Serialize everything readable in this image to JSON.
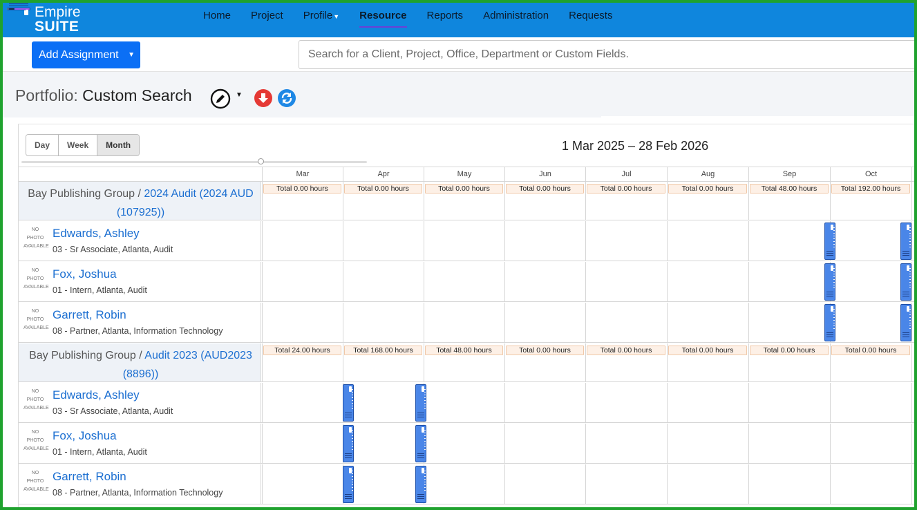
{
  "app": {
    "logo_line1": "Empire",
    "logo_line2": "SUITE"
  },
  "nav": {
    "items": [
      {
        "label": "Home"
      },
      {
        "label": "Project"
      },
      {
        "label": "Profile"
      },
      {
        "label": "Resource",
        "active": true
      },
      {
        "label": "Reports"
      },
      {
        "label": "Administration"
      },
      {
        "label": "Requests"
      }
    ]
  },
  "toolbar": {
    "add_assignment_label": "Add Assignment",
    "search_placeholder": "Search for a Client, Project, Office, Department or Custom Fields."
  },
  "header": {
    "title_prefix": "Portfolio:",
    "title_name": "Custom Search"
  },
  "calendar": {
    "views": [
      {
        "label": "Day"
      },
      {
        "label": "Week"
      },
      {
        "label": "Month",
        "active": true
      }
    ],
    "range": "1 Mar 2025 – 28 Feb 2026",
    "months": [
      "Mar",
      "Apr",
      "May",
      "Jun",
      "Jul",
      "Aug",
      "Sep",
      "Oct"
    ]
  },
  "projects": [
    {
      "client": "Bay Publishing Group /",
      "name_line1": "2024 Audit (2024 AUD",
      "name_line2": "(107925))",
      "totals": [
        "Total 0.00 hours",
        "Total 0.00 hours",
        "Total 0.00 hours",
        "Total 0.00 hours",
        "Total 0.00 hours",
        "Total 0.00 hours",
        "Total 48.00 hours",
        "Total 192.00 hours"
      ],
      "people": [
        {
          "photo": "NO PHOTO AVAILABLE",
          "name": "Edwards, Ashley",
          "desc": "03 - Sr Associate, Atlanta, Audit"
        },
        {
          "photo": "NO PHOTO AVAILABLE",
          "name": "Fox, Joshua",
          "desc": "01 - Intern, Atlanta, Audit"
        },
        {
          "photo": "NO PHOTO AVAILABLE",
          "name": "Garrett, Robin",
          "desc": "08 - Partner, Atlanta, Information Technology"
        }
      ]
    },
    {
      "client": "Bay Publishing Group /",
      "name_line1": "Audit 2023 (AUD2023",
      "name_line2": "(8896))",
      "totals": [
        "Total 24.00 hours",
        "Total 168.00 hours",
        "Total 48.00 hours",
        "Total 0.00 hours",
        "Total 0.00 hours",
        "Total 0.00 hours",
        "Total 0.00 hours",
        "Total 0.00 hours"
      ],
      "people": [
        {
          "photo": "NO PHOTO AVAILABLE",
          "name": "Edwards, Ashley",
          "desc": "03 - Sr Associate, Atlanta, Audit"
        },
        {
          "photo": "NO PHOTO AVAILABLE",
          "name": "Fox, Joshua",
          "desc": "01 - Intern, Atlanta, Audit"
        },
        {
          "photo": "NO PHOTO AVAILABLE",
          "name": "Garrett, Robin",
          "desc": "08 - Partner, Atlanta, Information Technology"
        }
      ]
    }
  ],
  "colors": {
    "navbar": "#0f86dd",
    "primary_button": "#0b6ff5",
    "link": "#1c6fd1",
    "assignment_bar": "#4a86e8",
    "frame": "#1fa22e"
  }
}
